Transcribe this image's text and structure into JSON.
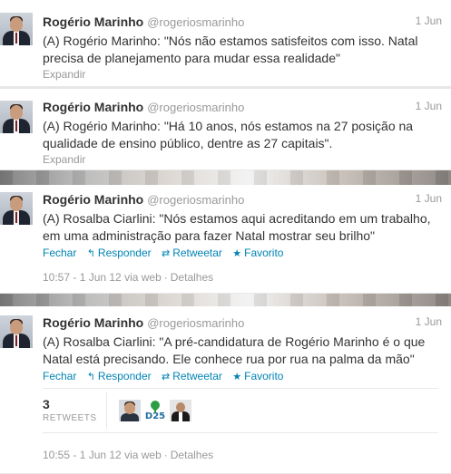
{
  "tweets": [
    {
      "name": "Rogério Marinho",
      "handle": "@rogeriosmarinho",
      "date": "1 Jun",
      "text": "(A) Rogério Marinho: \"Nós não estamos satisfeitos com isso. Natal precisa de planejamento para mudar essa realidade\"",
      "expand": "Expandir"
    },
    {
      "name": "Rogério Marinho",
      "handle": "@rogeriosmarinho",
      "date": "1 Jun",
      "text": "(A) Rogério Marinho: \"Há 10 anos, nós estamos na 27 posição na qualidade de ensino público, dentre as 27 capitais\".",
      "expand": "Expandir"
    },
    {
      "name": "Rogério Marinho",
      "handle": "@rogeriosmarinho",
      "date": "1 Jun",
      "text": "(A) Rosalba Ciarlini: \"Nós estamos aqui acreditando em um trabalho, em uma administração para fazer Natal mostrar seu brilho\"",
      "actions": {
        "close": "Fechar",
        "reply": "Responder",
        "retweet": "Retweetar",
        "favorite": "Favorito"
      },
      "timestamp": "10:57 - 1 Jun 12 via web",
      "details": "Detalhes"
    },
    {
      "name": "Rogério Marinho",
      "handle": "@rogeriosmarinho",
      "date": "1 Jun",
      "text": "(A) Rosalba Ciarlini: \"A pré-candidatura de Rogério Marinho é o que Natal está precisando. Ele conhece rua por rua na palma da mão\"",
      "actions": {
        "close": "Fechar",
        "reply": "Responder",
        "retweet": "Retweetar",
        "favorite": "Favorito"
      },
      "retweets": {
        "count": "3",
        "label": "RETWEETS",
        "avatar_badge": "D25"
      },
      "timestamp": "10:55 - 1 Jun 12 via web",
      "details": "Detalhes"
    }
  ],
  "icons": {
    "reply": "reply-arrow-icon",
    "retweet": "retweet-icon",
    "favorite": "star-icon"
  },
  "colors": {
    "link": "#0084b4",
    "muted": "#999999",
    "text": "#333333"
  }
}
